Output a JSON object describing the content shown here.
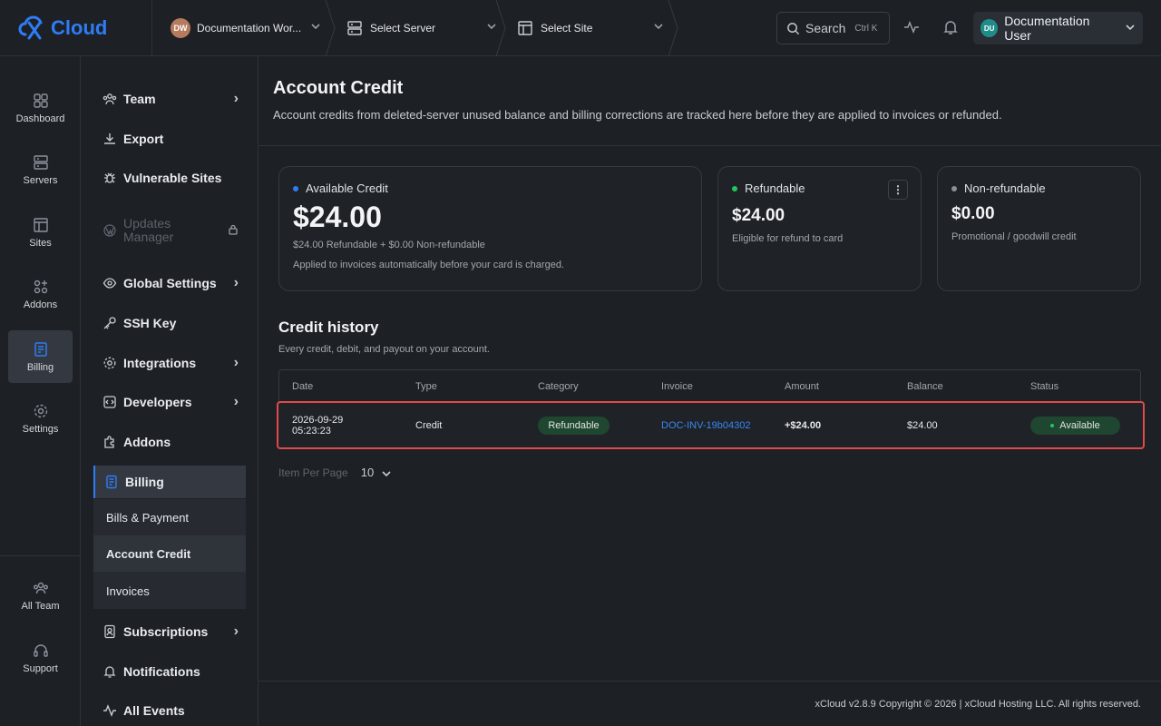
{
  "brand": {
    "name": "Cloud",
    "accent": "#2e7cf6"
  },
  "topbar": {
    "workspace": {
      "avatar": "DW",
      "label": "Documentation Wor..."
    },
    "server": {
      "label": "Select Server"
    },
    "site": {
      "label": "Select Site"
    },
    "search": {
      "label": "Search",
      "shortcut": "Ctrl K"
    },
    "user": {
      "avatar": "DU",
      "name": "Documentation User"
    }
  },
  "rail": {
    "items": [
      {
        "label": "Dashboard",
        "icon": "dashboard-icon"
      },
      {
        "label": "Servers",
        "icon": "server-icon"
      },
      {
        "label": "Sites",
        "icon": "sites-icon"
      },
      {
        "label": "Addons",
        "icon": "addons-icon"
      },
      {
        "label": "Billing",
        "icon": "billing-icon"
      },
      {
        "label": "Settings",
        "icon": "settings-icon"
      },
      {
        "label": "All Team",
        "icon": "team-icon"
      },
      {
        "label": "Support",
        "icon": "headset-icon"
      }
    ]
  },
  "nav": {
    "items": [
      {
        "label": "Team"
      },
      {
        "label": "Export"
      },
      {
        "label": "Vulnerable Sites"
      },
      {
        "label": "Updates Manager"
      },
      {
        "label": "Global Settings"
      },
      {
        "label": "SSH Key"
      },
      {
        "label": "Integrations"
      },
      {
        "label": "Developers"
      },
      {
        "label": "Addons"
      },
      {
        "label": "Billing"
      },
      {
        "label": "Subscriptions"
      },
      {
        "label": "Notifications"
      },
      {
        "label": "All Events"
      }
    ],
    "billing_sub": [
      {
        "label": "Bills & Payment"
      },
      {
        "label": "Account Credit"
      },
      {
        "label": "Invoices"
      }
    ]
  },
  "page": {
    "title": "Account Credit",
    "description": "Account credits from deleted-server unused balance and billing corrections are tracked here before they are applied to invoices or refunded."
  },
  "cards": {
    "available": {
      "label": "Available Credit",
      "amount": "$24.00",
      "breakdown": "$24.00 Refundable + $0.00 Non-refundable",
      "note": "Applied to invoices automatically before your card is charged.",
      "dot_color": "#2e7cf6"
    },
    "refundable": {
      "label": "Refundable",
      "amount": "$24.00",
      "note": "Eligible for refund to card",
      "dot_color": "#22c55e"
    },
    "nonrefundable": {
      "label": "Non-refundable",
      "amount": "$0.00",
      "note": "Promotional / goodwill credit",
      "dot_color": "#8a9099"
    }
  },
  "history": {
    "title": "Credit history",
    "subtitle": "Every credit, debit, and payout on your account.",
    "columns": [
      "Date",
      "Type",
      "Category",
      "Invoice",
      "Amount",
      "Balance",
      "Status"
    ],
    "rows": [
      {
        "date": "2026-09-29",
        "time": "05:23:23",
        "type": "Credit",
        "category": "Refundable",
        "invoice": "DOC-INV-19b04302",
        "amount": "+$24.00",
        "balance": "$24.00",
        "status": "Available"
      }
    ]
  },
  "pager": {
    "label": "Item Per Page",
    "value": "10"
  },
  "footer": {
    "text": "xCloud v2.8.9 Copyright © 2026 | xCloud Hosting LLC. All rights reserved."
  }
}
